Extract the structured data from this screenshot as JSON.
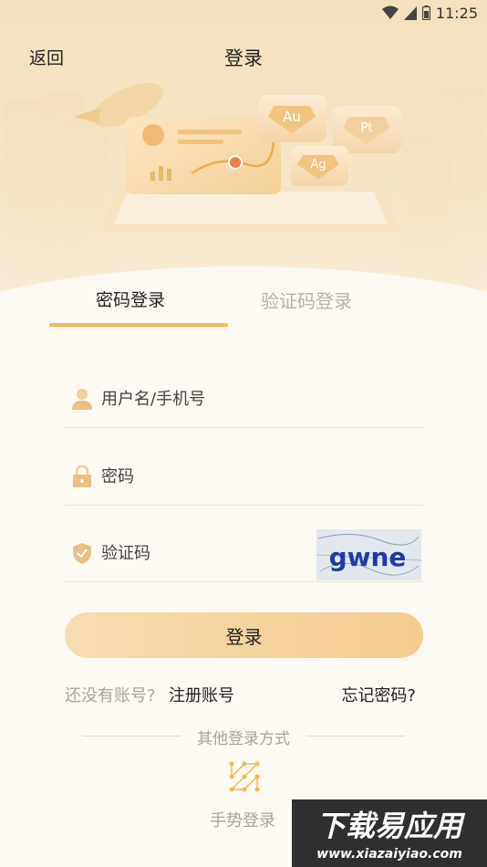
{
  "status_bar": {
    "time": "11:25"
  },
  "nav": {
    "back": "返回",
    "title": "登录"
  },
  "hero": {
    "badges": [
      "Au",
      "Pt",
      "Ag"
    ]
  },
  "tabs": {
    "password": "密码登录",
    "code": "验证码登录"
  },
  "form": {
    "username_placeholder": "用户名/手机号",
    "password_placeholder": "密码",
    "code_placeholder": "验证码",
    "captcha_text": "gwne",
    "login_button": "登录"
  },
  "links": {
    "no_account": "还没有账号?",
    "register": "注册账号",
    "forgot": "忘记密码?"
  },
  "other_login": {
    "label": "其他登录方式",
    "gesture": "手势登录"
  },
  "watermark": {
    "title": "下载易应用",
    "url": "www.xiazaiyiao.com"
  },
  "colors": {
    "accent": "#f2b955",
    "button_start": "#f8dcb1",
    "button_end": "#f5cc8f",
    "muted": "#aaa49b"
  },
  "icons": {
    "wifi": "wifi-icon",
    "signal": "signal-icon",
    "battery": "battery-icon",
    "user": "user-icon",
    "lock": "lock-icon",
    "shield": "shield-icon",
    "gesture": "gesture-icon"
  }
}
